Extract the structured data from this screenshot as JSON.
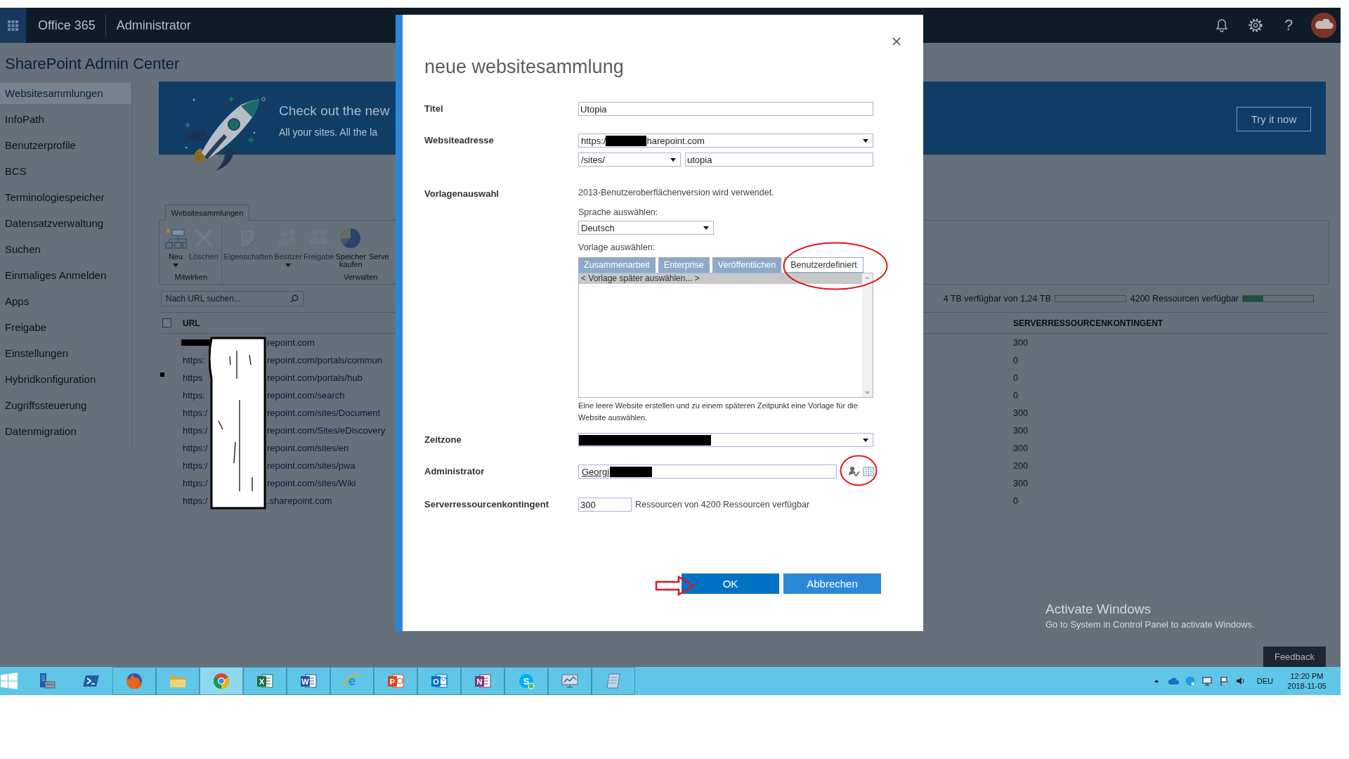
{
  "header": {
    "app_name": "Office 365",
    "section": "Administrator",
    "help": "?"
  },
  "page_title": "SharePoint Admin Center",
  "sidebar": {
    "items": [
      {
        "label": "Websitesammlungen",
        "selected": true
      },
      {
        "label": "InfoPath",
        "selected": false
      },
      {
        "label": "Benutzerprofile",
        "selected": false
      },
      {
        "label": "BCS",
        "selected": false
      },
      {
        "label": "Terminologiespeicher",
        "selected": false
      },
      {
        "label": "Datensatzverwaltung",
        "selected": false
      },
      {
        "label": "Suchen",
        "selected": false
      },
      {
        "label": "Einmaliges Anmelden",
        "selected": false
      },
      {
        "label": "Apps",
        "selected": false
      },
      {
        "label": "Freigabe",
        "selected": false
      },
      {
        "label": "Einstellungen",
        "selected": false
      },
      {
        "label": "Hybridkonfiguration",
        "selected": false
      },
      {
        "label": "Zugriffssteuerung",
        "selected": false
      },
      {
        "label": "Datenmigration",
        "selected": false
      }
    ]
  },
  "banner": {
    "heading": "Check out the new",
    "subtext": "All your sites. All the la",
    "button": "Try it now"
  },
  "ribbon": {
    "tab": "Websitesammlungen",
    "groups": [
      {
        "label": "Mitwirken",
        "commands": [
          {
            "kind": "new",
            "label": "Neu",
            "dropdown": true,
            "disabled": false
          },
          {
            "kind": "delete",
            "label": "Löschen",
            "dropdown": false,
            "disabled": true
          }
        ]
      },
      {
        "label": "Verwalten",
        "commands": [
          {
            "kind": "properties",
            "label": "Eigenschaften",
            "dropdown": false,
            "disabled": true
          },
          {
            "kind": "owners",
            "label": "Besitzer",
            "dropdown": true,
            "disabled": true
          },
          {
            "kind": "sharing",
            "label": "Freigabe",
            "dropdown": false,
            "disabled": true
          },
          {
            "kind": "storage",
            "label": "Speicher kaufen",
            "dropdown": false,
            "disabled": false
          },
          {
            "kind": "server",
            "label": "Serve",
            "dropdown": false,
            "disabled": false
          }
        ]
      }
    ]
  },
  "search": {
    "placeholder": "Nach URL suchen..."
  },
  "usage": {
    "storage": {
      "label": "4 TB verfügbar von 1,24 TB",
      "level": 0
    },
    "resources": {
      "label": "4200 Ressourcen verfügbar",
      "level": 0.29
    }
  },
  "table": {
    "columns": [
      "URL",
      "SERVERRESSOURCENKONTINGENT"
    ],
    "select_all_checked": false,
    "scribble_redaction": true,
    "rows": [
      {
        "prefix_redacted": true,
        "url_end": "repoint.com",
        "quota": "300",
        "marked": false
      },
      {
        "prefix_redacted": false,
        "url_start": "https:",
        "url_end": "repoint.com/portals/commun",
        "quota": "0",
        "marked": false
      },
      {
        "prefix_redacted": false,
        "url_start": "https",
        "url_end": "repoint.com/portals/hub",
        "quota": "0",
        "marked": true
      },
      {
        "prefix_redacted": false,
        "url_start": "https:",
        "url_end": "repoint.com/search",
        "quota": "0",
        "marked": false
      },
      {
        "prefix_redacted": false,
        "url_start": "https:/",
        "url_end": "repoint.com/sites/Document",
        "quota": "300",
        "marked": false
      },
      {
        "prefix_redacted": false,
        "url_start": "https:/",
        "url_end": "repoint.com/Sites/eDiscovery",
        "quota": "300",
        "marked": false
      },
      {
        "prefix_redacted": false,
        "url_start": "https:/",
        "url_end": "repoint.com/sites/en",
        "quota": "300",
        "marked": false
      },
      {
        "prefix_redacted": false,
        "url_start": "https:/",
        "url_end": "repoint.com/sites/pwa",
        "quota": "200",
        "marked": false
      },
      {
        "prefix_redacted": false,
        "url_start": "https:/",
        "url_end": "repoint.com/sites/Wiki",
        "quota": "300",
        "marked": false
      },
      {
        "prefix_redacted": false,
        "url_start": "https:/",
        "url_end": ".sharepoint.com",
        "quota": "0",
        "marked": false
      }
    ]
  },
  "dialog": {
    "title": "neue websitesammlung",
    "fields": [
      {
        "kind": "text",
        "label": "Titel",
        "value": "Utopia"
      },
      {
        "kind": "address",
        "label": "Websiteadresse",
        "domain_start": "https:/",
        "domain_redacted": true,
        "domain_end": "harepoint.com",
        "path": "/sites/",
        "name": "utopia"
      },
      {
        "kind": "template",
        "label": "Vorlagenauswahl",
        "version_note": "2013-Benutzeroberflächenversion wird verwendet.",
        "language_caption": "Sprache auswählen:",
        "language": "Deutsch",
        "template_caption": "Vorlage auswählen:",
        "tabs": [
          {
            "label": "Zusammenarbeit",
            "selected": false,
            "circled": false
          },
          {
            "label": "Enterprise",
            "selected": false,
            "circled": false
          },
          {
            "label": "Veröffentlichen",
            "selected": false,
            "circled": false
          },
          {
            "label": "Benutzerdefiniert",
            "selected": true,
            "circled": true
          }
        ],
        "templates": [
          {
            "label": "< Vorlage später auswählen... >",
            "selected": true
          }
        ],
        "description": "Eine leere Website erstellen und zu einem späteren Zeitpunkt eine Vorlage für die Website auswählen."
      },
      {
        "kind": "timezone",
        "label": "Zeitzone",
        "value_redacted": true
      },
      {
        "kind": "people",
        "label": "Administrator",
        "value": "Georgi",
        "value_redacted": true,
        "pickers_circled": true
      },
      {
        "kind": "quota",
        "label": "Serverressourcenkontingent",
        "value": "300",
        "note": "Ressourcen von 4200 Ressourcen verfügbar"
      }
    ],
    "buttons": [
      {
        "label": "OK",
        "primary": true,
        "arrow": true
      },
      {
        "label": "Abbrechen",
        "primary": false,
        "arrow": false
      }
    ]
  },
  "activation": {
    "title": "Activate Windows",
    "text": "Go to System in Control Panel to activate Windows."
  },
  "feedback_button": "Feedback",
  "taskbar": {
    "apps": [
      {
        "kind": "server-manager",
        "running": false,
        "active": false
      },
      {
        "kind": "powershell",
        "running": false,
        "active": false
      },
      {
        "kind": "firefox",
        "running": true,
        "active": false
      },
      {
        "kind": "explorer",
        "running": true,
        "active": false
      },
      {
        "kind": "chrome",
        "running": true,
        "active": true
      },
      {
        "kind": "excel",
        "glyph": "X",
        "running": true,
        "active": false
      },
      {
        "kind": "word",
        "glyph": "W",
        "running": true,
        "active": false
      },
      {
        "kind": "ie",
        "glyph": "e",
        "running": true,
        "active": false
      },
      {
        "kind": "powerpoint",
        "glyph": "P",
        "running": true,
        "active": false
      },
      {
        "kind": "outlook",
        "glyph": "O",
        "running": true,
        "active": false
      },
      {
        "kind": "onenote",
        "glyph": "N",
        "running": true,
        "active": false
      },
      {
        "kind": "skype",
        "glyph": "S",
        "running": true,
        "active": false
      },
      {
        "kind": "monitor",
        "running": true,
        "active": false
      },
      {
        "kind": "notepad",
        "running": true,
        "active": false
      }
    ],
    "tray": {
      "language": "DEU",
      "time": "12:20 PM",
      "date": "2018-11-05"
    }
  }
}
